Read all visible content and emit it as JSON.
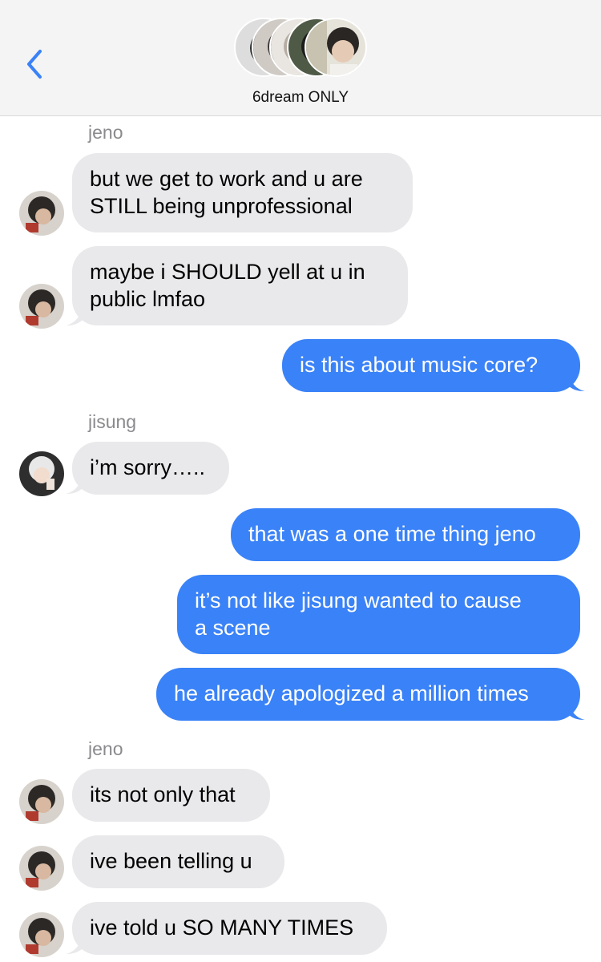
{
  "header": {
    "group_name": "6dream ONLY",
    "back_icon": "chevron-left-icon",
    "accent_color": "#3a82f7"
  },
  "colors": {
    "incoming_bubble": "#e9e9eb",
    "outgoing_bubble": "#3a82f7",
    "sender_label": "#8a8a8e"
  },
  "senders": [
    "jeno",
    "jisung",
    "jeno"
  ],
  "messages": [
    {
      "from": "jeno",
      "text": "but we get to work and u are\nSTILL being unprofessional"
    },
    {
      "from": "jeno",
      "text": "maybe i SHOULD yell at u in\npublic lmfao"
    },
    {
      "from": "me",
      "text": "is this about music core?"
    },
    {
      "from": "jisung",
      "text": "i’m sorry….."
    },
    {
      "from": "me",
      "text": "that was a one time thing jeno"
    },
    {
      "from": "me",
      "text": "it’s not like jisung wanted to cause\na scene"
    },
    {
      "from": "me",
      "text": "he already apologized a million times"
    },
    {
      "from": "jeno",
      "text": "its not only that"
    },
    {
      "from": "jeno",
      "text": "ive been telling u"
    },
    {
      "from": "jeno",
      "text": "ive told u SO MANY TIMES"
    }
  ]
}
